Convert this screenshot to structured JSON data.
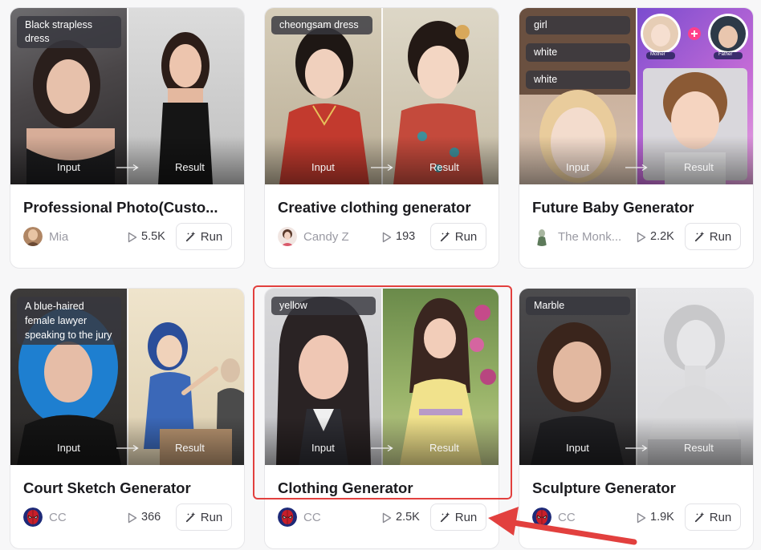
{
  "labels": {
    "input": "Input",
    "result": "Result",
    "run": "Run"
  },
  "colors": {
    "highlight": "#e2403e",
    "tag_bg": "#37373e"
  },
  "cards": [
    {
      "title": "Professional Photo(Custo...",
      "author": "Mia",
      "runs": "5.5K",
      "tags": [
        "Black strapless dress"
      ],
      "avatar_icon": "portrait-avatar"
    },
    {
      "title": "Creative clothing generator",
      "author": "Candy Z",
      "runs": "193",
      "tags": [
        "cheongsam dress"
      ],
      "avatar_icon": "girl-avatar"
    },
    {
      "title": "Future Baby Generator",
      "author": "The Monk...",
      "runs": "2.2K",
      "tags": [
        "girl",
        "white",
        "white"
      ],
      "avatar_icon": "monk-avatar",
      "parents": {
        "mother": "Mother",
        "father": "Father"
      }
    },
    {
      "title": "Court Sketch Generator",
      "author": "CC",
      "runs": "366",
      "tags": [
        "A blue-haired female lawyer speaking to the jury"
      ],
      "avatar_icon": "spider-mask-avatar"
    },
    {
      "title": "Clothing Generator",
      "author": "CC",
      "runs": "2.5K",
      "tags": [
        "yellow"
      ],
      "avatar_icon": "spider-mask-avatar"
    },
    {
      "title": "Sculpture Generator",
      "author": "CC",
      "runs": "1.9K",
      "tags": [
        "Marble"
      ],
      "avatar_icon": "spider-mask-avatar"
    }
  ]
}
